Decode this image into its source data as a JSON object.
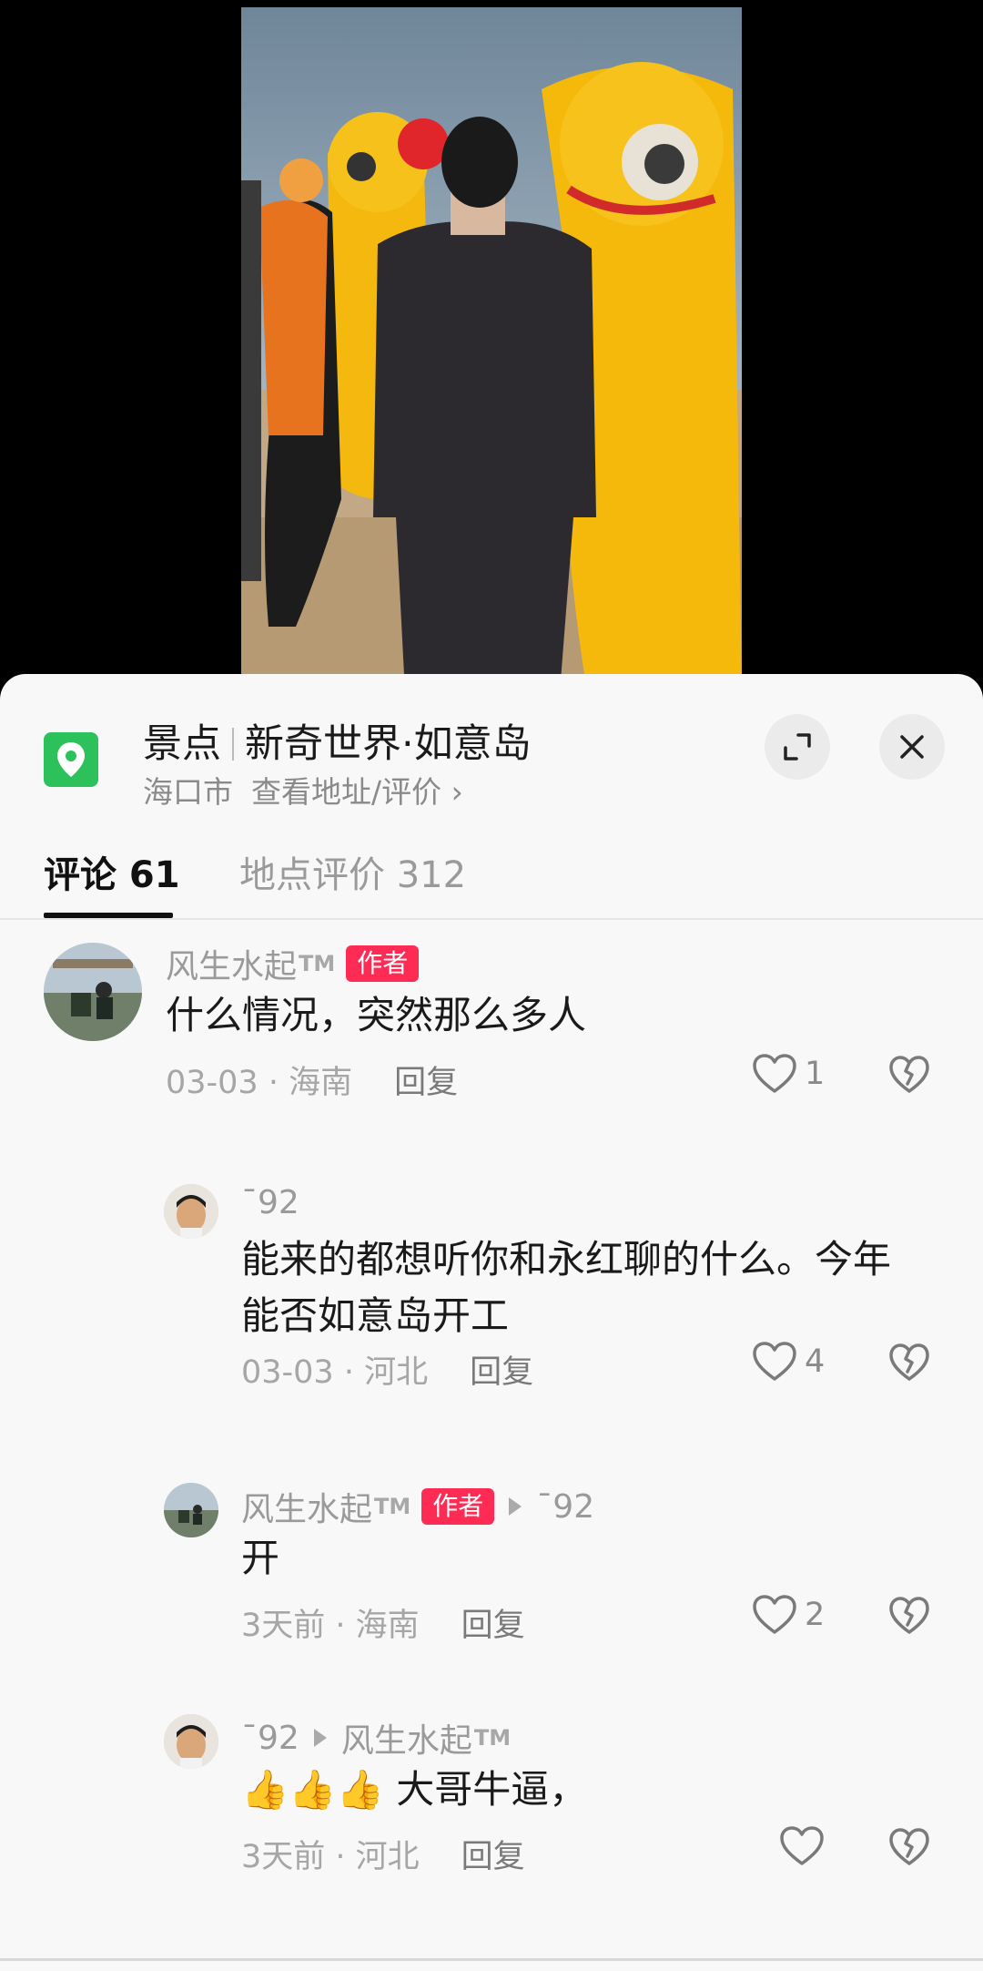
{
  "location": {
    "category": "景点",
    "name": "新奇世界·如意岛",
    "city": "海口市",
    "link": "查看地址/评价 ›"
  },
  "tabs": [
    {
      "label": "评论 61"
    },
    {
      "label": "地点评价 312"
    }
  ],
  "author_badge": "作者",
  "comments": [
    {
      "user": "风生水起",
      "user_suffix": "TM",
      "text": "什么情况，突然那么多人",
      "meta": "03-03 · 海南",
      "reply_label": "回复",
      "likes": "1"
    },
    {
      "user": "ˉ92",
      "text_line1": "能来的都想听你和永红聊的什么。今年",
      "text_line2": "能否如意岛开工",
      "meta": "03-03 · 河北",
      "reply_label": "回复",
      "likes": "4"
    },
    {
      "user": "风生水起",
      "user_suffix": "TM",
      "reply_to": "ˉ92",
      "text": "开",
      "meta": "3天前 · 海南",
      "reply_label": "回复",
      "likes": "2"
    },
    {
      "user": "ˉ92",
      "reply_to": "风生水起",
      "reply_to_suffix": "TM",
      "emoji": "👍👍👍",
      "text": "大哥牛逼，",
      "meta": "3天前 · 河北",
      "reply_label": "回复",
      "likes": ""
    }
  ],
  "icons": [
    "location-pin-icon",
    "expand-icon",
    "close-icon",
    "heart-icon",
    "broken-heart-icon",
    "reply-arrow-icon"
  ],
  "colors": {
    "accent": "#fe2c55",
    "pin": "#2cc15a",
    "sheet": "#f8f8f8"
  }
}
